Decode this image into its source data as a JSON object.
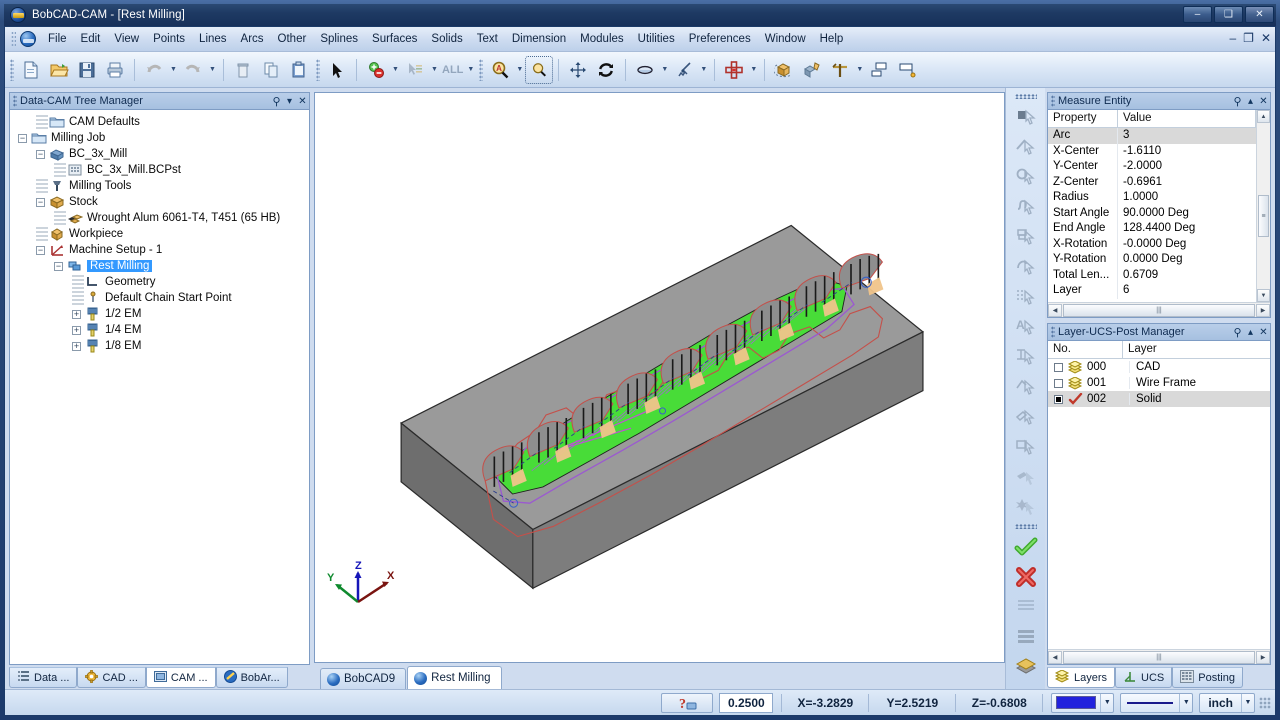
{
  "window": {
    "title": "BobCAD-CAM - [Rest Milling]",
    "minimize": "–",
    "maximize": "❑",
    "close": "✕",
    "mdi_minimize": "–",
    "mdi_restore": "❐",
    "mdi_close": "✕"
  },
  "menubar": {
    "items": [
      {
        "label": "File"
      },
      {
        "label": "Edit"
      },
      {
        "label": "View"
      },
      {
        "label": "Points"
      },
      {
        "label": "Lines"
      },
      {
        "label": "Arcs"
      },
      {
        "label": "Other"
      },
      {
        "label": "Splines"
      },
      {
        "label": "Surfaces"
      },
      {
        "label": "Solids"
      },
      {
        "label": "Text"
      },
      {
        "label": "Dimension"
      },
      {
        "label": "Modules"
      },
      {
        "label": "Utilities"
      },
      {
        "label": "Preferences"
      },
      {
        "label": "Window"
      },
      {
        "label": "Help"
      }
    ]
  },
  "toolbar": {
    "all_label": "ALL",
    "buttons": [
      {
        "name": "new-file-button"
      },
      {
        "name": "open-file-button"
      },
      {
        "name": "save-file-button"
      },
      {
        "name": "print-button"
      },
      {
        "name": "undo-button"
      },
      {
        "name": "redo-button"
      },
      {
        "name": "delete-button"
      },
      {
        "name": "copy-button"
      },
      {
        "name": "paste-button"
      },
      {
        "name": "select-arrow-button"
      },
      {
        "name": "add-remove-selection-button"
      },
      {
        "name": "select-chain-button"
      },
      {
        "name": "zoom-window-button"
      },
      {
        "name": "zoom-rectangle-button"
      },
      {
        "name": "pan-button"
      },
      {
        "name": "rotate-button"
      },
      {
        "name": "shade-button"
      },
      {
        "name": "dynamic-rotate-button"
      },
      {
        "name": "ucs-button"
      },
      {
        "name": "render-solid-button"
      },
      {
        "name": "simulate-button"
      },
      {
        "name": "axis-button"
      },
      {
        "name": "viewport-layout-button"
      },
      {
        "name": "viewport-single-button"
      }
    ]
  },
  "tree_panel": {
    "title": "Data-CAM Tree Manager",
    "nodes": [
      {
        "label": "CAM Defaults",
        "depth": 1,
        "expander": "",
        "icon": "folder-icon"
      },
      {
        "label": "Milling Job",
        "depth": 0,
        "expander": "−",
        "icon": "folder-icon"
      },
      {
        "label": "BC_3x_Mill",
        "depth": 1,
        "expander": "−",
        "icon": "machine-icon"
      },
      {
        "label": "BC_3x_Mill.BCPst",
        "depth": 2,
        "expander": "",
        "icon": "post-icon"
      },
      {
        "label": "Milling Tools",
        "depth": 1,
        "expander": "",
        "icon": "tool-icon"
      },
      {
        "label": "Stock",
        "depth": 1,
        "expander": "−",
        "icon": "stock-icon"
      },
      {
        "label": "Wrought Alum 6061-T4, T451 (65 HB)",
        "depth": 2,
        "expander": "",
        "icon": "material-icon"
      },
      {
        "label": "Workpiece",
        "depth": 1,
        "expander": "",
        "icon": "workpiece-icon"
      },
      {
        "label": "Machine Setup - 1",
        "depth": 1,
        "expander": "−",
        "icon": "setup-icon"
      },
      {
        "label": "Rest Milling",
        "depth": 2,
        "expander": "−",
        "icon": "operation-icon",
        "selected": true
      },
      {
        "label": "Geometry",
        "depth": 3,
        "expander": "",
        "icon": "geometry-icon"
      },
      {
        "label": "Default Chain Start Point",
        "depth": 3,
        "expander": "",
        "icon": "startpoint-icon"
      },
      {
        "label": "1/2 EM",
        "depth": 3,
        "expander": "+",
        "icon": "endmill-icon"
      },
      {
        "label": "1/4 EM",
        "depth": 3,
        "expander": "+",
        "icon": "endmill-icon"
      },
      {
        "label": "1/8 EM",
        "depth": 3,
        "expander": "+",
        "icon": "endmill-icon"
      }
    ]
  },
  "dock_tabs": {
    "items": [
      {
        "label": "Data ...",
        "icon": "data-tree-icon",
        "active": false
      },
      {
        "label": "CAD ...",
        "icon": "cad-gear-icon",
        "active": false
      },
      {
        "label": "CAM ...",
        "icon": "cam-window-icon",
        "active": true
      },
      {
        "label": "BobAr...",
        "icon": "bobart-icon",
        "active": false
      }
    ]
  },
  "viewport": {
    "tabs": [
      {
        "label": "BobCAD9",
        "active": false
      },
      {
        "label": "Rest Milling",
        "active": true
      }
    ],
    "axis": {
      "x": "X",
      "y": "Y",
      "z": "Z"
    }
  },
  "measure_panel": {
    "title": "Measure Entity",
    "columns": [
      "Property",
      "Value"
    ],
    "rows": [
      {
        "property": "Arc",
        "value": "3",
        "selected": true
      },
      {
        "property": "X-Center",
        "value": "-1.6110"
      },
      {
        "property": "Y-Center",
        "value": "-2.0000"
      },
      {
        "property": "Z-Center",
        "value": "-0.6961"
      },
      {
        "property": "Radius",
        "value": "1.0000"
      },
      {
        "property": "Start Angle",
        "value": "90.0000 Deg"
      },
      {
        "property": "End Angle",
        "value": "128.4400 Deg"
      },
      {
        "property": "X-Rotation",
        "value": "-0.0000 Deg"
      },
      {
        "property": "Y-Rotation",
        "value": "0.0000 Deg"
      },
      {
        "property": "Total Len...",
        "value": "0.6709"
      },
      {
        "property": "Layer",
        "value": "6"
      }
    ]
  },
  "layer_panel": {
    "title": "Layer-UCS-Post Manager",
    "columns": [
      "No.",
      "Layer"
    ],
    "rows": [
      {
        "no": "000",
        "layer": "CAD",
        "checked": false,
        "icon": "layers-icon"
      },
      {
        "no": "001",
        "layer": "Wire Frame",
        "checked": false,
        "icon": "layers-icon"
      },
      {
        "no": "002",
        "layer": "Solid",
        "checked": true,
        "icon": "check-mark-icon",
        "selected": true
      }
    ],
    "tabs": [
      {
        "label": "Layers",
        "icon": "layers-icon",
        "active": true
      },
      {
        "label": "UCS",
        "icon": "ucs-icon",
        "active": false
      },
      {
        "label": "Posting",
        "icon": "posting-icon",
        "active": false
      }
    ]
  },
  "statusbar": {
    "snap_button": "snap-icon",
    "value": "0.2500",
    "x": "X=-3.2829",
    "y": "Y=2.5219",
    "z": "Z=-0.6808",
    "color_swatch": "#2222dd",
    "line_style": "solid-line",
    "units": "inch",
    "caret": "▼"
  },
  "colors": {
    "accent": "#3399ff",
    "titlebar": "#1e3a63",
    "panel": "#cfdcef",
    "stock_top": "#9a9a9a",
    "stock_side": "#6e6e6e",
    "toolpath_green": "#44e033",
    "toolpath_purple": "#9b59d0"
  }
}
